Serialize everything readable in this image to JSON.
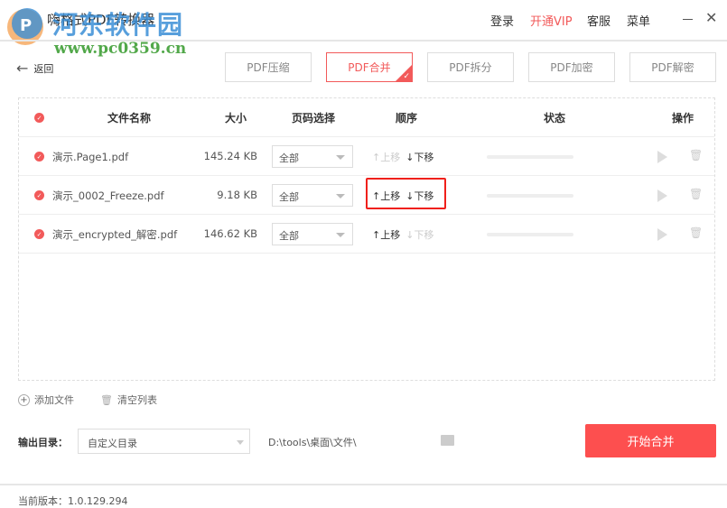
{
  "app": {
    "title": "嗨格式PDF转换器",
    "watermark_name": "河东软件园",
    "watermark_url": "www.pc0359.cn"
  },
  "menu": {
    "login": "登录",
    "vip": "开通VIP",
    "service": "客服",
    "menu": "菜单"
  },
  "back_label": "返回",
  "tabs": [
    {
      "label": "PDF压缩"
    },
    {
      "label": "PDF合并",
      "active": true
    },
    {
      "label": "PDF拆分"
    },
    {
      "label": "PDF加密"
    },
    {
      "label": "PDF解密"
    }
  ],
  "table": {
    "headers": {
      "name": "文件名称",
      "size": "大小",
      "pages": "页码选择",
      "order": "顺序",
      "status": "状态",
      "actions": "操作"
    },
    "rows": [
      {
        "name": "演示.Page1.pdf",
        "size": "145.24 KB",
        "pages": "全部",
        "up": "上移",
        "down": "下移",
        "up_enabled": false,
        "down_enabled": true,
        "progress": 0
      },
      {
        "name": "演示_0002_Freeze.pdf",
        "size": "9.18 KB",
        "pages": "全部",
        "up": "上移",
        "down": "下移",
        "up_enabled": true,
        "down_enabled": true,
        "progress": 0
      },
      {
        "name": "演示_encrypted_解密.pdf",
        "size": "146.62 KB",
        "pages": "全部",
        "up": "上移",
        "down": "下移",
        "up_enabled": true,
        "down_enabled": false,
        "progress": 0
      }
    ]
  },
  "actions": {
    "add_file": "添加文件",
    "clear_list": "清空列表"
  },
  "output": {
    "label": "输出目录：",
    "select": "自定义目录",
    "path": "D:\\tools\\桌面\\文件\\"
  },
  "start_button": "开始合并",
  "version": "当前版本：1.0.129.294",
  "colors": {
    "accent": "#fd4f4f",
    "highlight": "#f0201b"
  }
}
